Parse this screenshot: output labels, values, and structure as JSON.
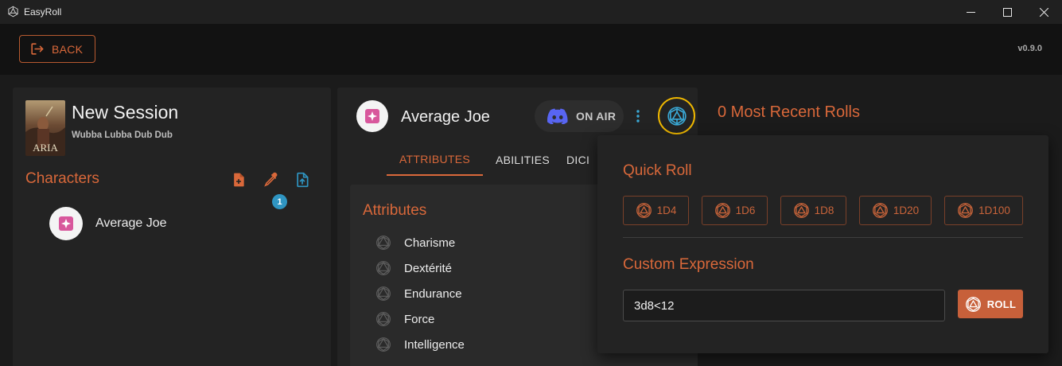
{
  "window": {
    "title": "EasyRoll"
  },
  "header": {
    "back_label": "BACK",
    "version": "v0.9.0"
  },
  "session": {
    "name": "New Session",
    "subtitle": "Wubba Lubba Dub Dub",
    "cover_text": "ARIA"
  },
  "characters": {
    "title": "Characters",
    "badge_count": "1",
    "items": [
      {
        "name": "Average Joe"
      }
    ]
  },
  "character_view": {
    "name": "Average Joe",
    "on_air_label": "ON AIR",
    "tabs": [
      {
        "label": "ATTRIBUTES",
        "active": true
      },
      {
        "label": "ABILITIES",
        "active": false
      },
      {
        "label": "DICI",
        "active": false
      }
    ],
    "attributes_title": "Attributes",
    "attributes": [
      "Charisme",
      "Dextérité",
      "Endurance",
      "Force",
      "Intelligence"
    ]
  },
  "recent_rolls": {
    "title": "0 Most Recent Rolls"
  },
  "roll_popup": {
    "quick_roll_title": "Quick Roll",
    "dice": [
      "1D4",
      "1D6",
      "1D8",
      "1D20",
      "1D100"
    ],
    "custom_title": "Custom Expression",
    "expression_value": "3d8<12",
    "roll_label": "ROLL"
  },
  "colors": {
    "accent": "#d9683a",
    "badge": "#2f95c2",
    "discord": "#5865f2",
    "dice_toggle_ring": "#f0b800",
    "dice_toggle_icon": "#3aa9d6"
  },
  "icons": {
    "back": "logout-icon",
    "new_character": "file-plus-icon",
    "edit_character": "eyedropper-icon",
    "upload": "file-upload-icon",
    "discord": "discord-icon",
    "dice": "d20-icon"
  }
}
